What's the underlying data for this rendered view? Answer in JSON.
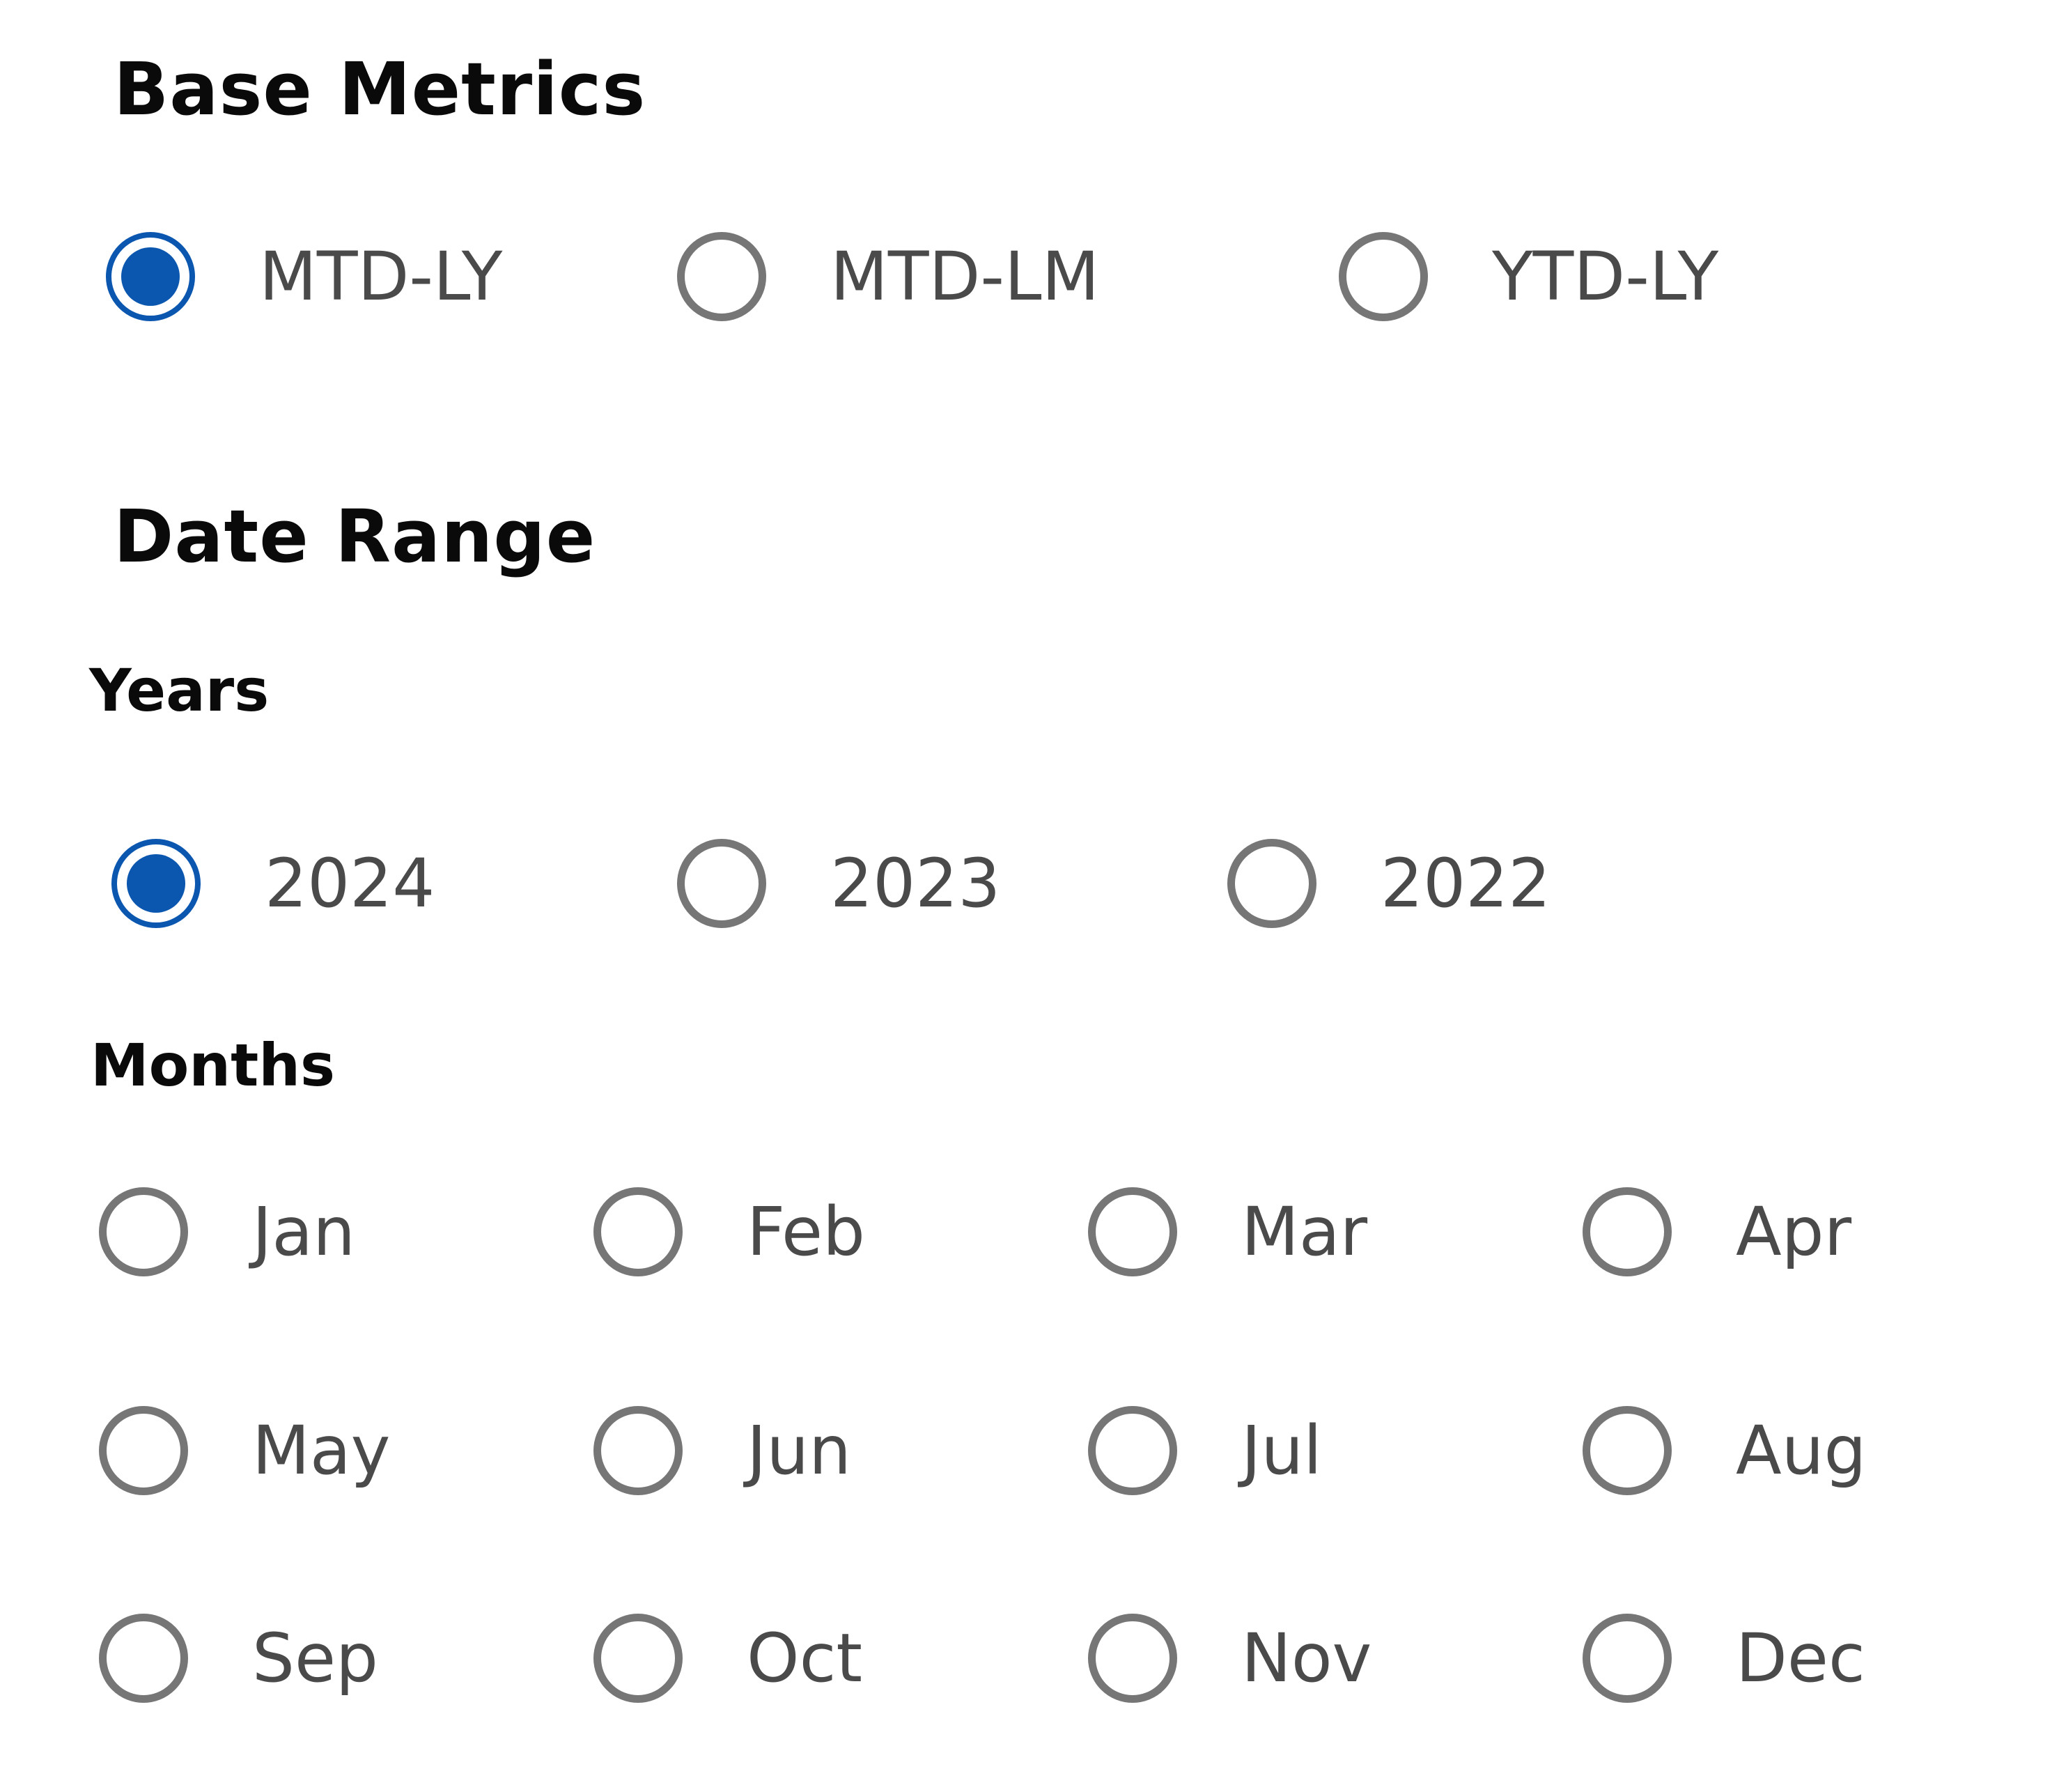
{
  "base_metrics": {
    "title": "Base Metrics",
    "options": [
      {
        "label": "MTD-LY",
        "selected": true
      },
      {
        "label": "MTD-LM",
        "selected": false
      },
      {
        "label": "YTD-LY",
        "selected": false
      }
    ]
  },
  "date_range": {
    "title": "Date Range",
    "years": {
      "title": "Years",
      "options": [
        {
          "label": "2024",
          "selected": true
        },
        {
          "label": "2023",
          "selected": false
        },
        {
          "label": "2022",
          "selected": false
        }
      ]
    },
    "months": {
      "title": "Months",
      "options": [
        {
          "label": "Jan",
          "selected": false
        },
        {
          "label": "Feb",
          "selected": false
        },
        {
          "label": "Mar",
          "selected": false
        },
        {
          "label": "Apr",
          "selected": false
        },
        {
          "label": "May",
          "selected": false
        },
        {
          "label": "Jun",
          "selected": false
        },
        {
          "label": "Jul",
          "selected": false
        },
        {
          "label": "Aug",
          "selected": false
        },
        {
          "label": "Sep",
          "selected": false
        },
        {
          "label": "Oct",
          "selected": false
        },
        {
          "label": "Nov",
          "selected": false
        },
        {
          "label": "Dec",
          "selected": false
        }
      ]
    }
  },
  "colors": {
    "accent": "#0b57b0",
    "radio_border": "#767676",
    "label_text": "#4a4a4a",
    "heading_text": "#0a0a0a"
  }
}
